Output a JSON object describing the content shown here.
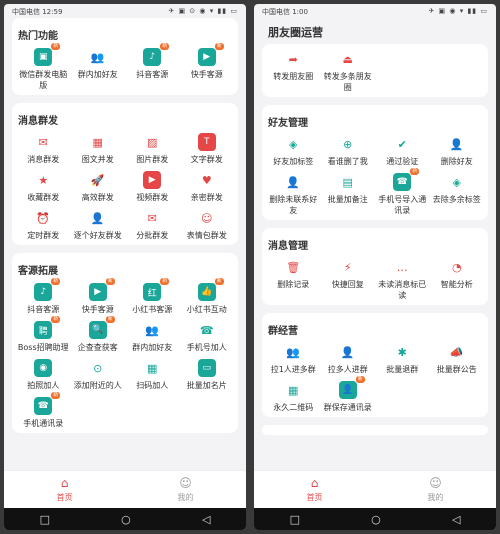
{
  "left": {
    "status": {
      "carrier": "中国电信 12:59",
      "icons": "✈ ▣ ⊙ ◉ ▾ ▮▮ ▭"
    },
    "sections": [
      {
        "title": "热门功能",
        "items": [
          {
            "label": "微信群发电脑版",
            "icon": "▣",
            "style": "tealbg",
            "badge": "新"
          },
          {
            "label": "群内加好友",
            "icon": "👥",
            "style": "teal"
          },
          {
            "label": "抖音客源",
            "icon": "♪",
            "style": "tealbg",
            "badge": "新"
          },
          {
            "label": "快手客源",
            "icon": "▶",
            "style": "tealbg",
            "badge": "新"
          }
        ]
      },
      {
        "title": "消息群发",
        "items": [
          {
            "label": "消息群发",
            "icon": "✉",
            "style": "red"
          },
          {
            "label": "图文并发",
            "icon": "▦",
            "style": "red"
          },
          {
            "label": "图片群发",
            "icon": "▨",
            "style": "red"
          },
          {
            "label": "文字群发",
            "icon": "T",
            "style": "redbg"
          },
          {
            "label": "收藏群发",
            "icon": "★",
            "style": "red"
          },
          {
            "label": "高效群发",
            "icon": "🚀",
            "style": "red"
          },
          {
            "label": "视频群发",
            "icon": "▶",
            "style": "redbg"
          },
          {
            "label": "亲密群发",
            "icon": "♥",
            "style": "red"
          },
          {
            "label": "定时群发",
            "icon": "⏰",
            "style": "red"
          },
          {
            "label": "逐个好友群发",
            "icon": "👤",
            "style": "red"
          },
          {
            "label": "分批群发",
            "icon": "✉",
            "style": "red"
          },
          {
            "label": "表情包群发",
            "icon": "☺",
            "style": "red"
          }
        ]
      },
      {
        "title": "客源拓展",
        "items": [
          {
            "label": "抖音客源",
            "icon": "♪",
            "style": "tealbg",
            "badge": "新"
          },
          {
            "label": "快手客源",
            "icon": "▶",
            "style": "tealbg",
            "badge": "新"
          },
          {
            "label": "小红书客源",
            "icon": "红",
            "style": "tealbg",
            "badge": "新"
          },
          {
            "label": "小红书互动",
            "icon": "👍",
            "style": "tealbg",
            "badge": "新"
          },
          {
            "label": "Boss招聘助理",
            "icon": "聘",
            "style": "tealbg",
            "badge": "新"
          },
          {
            "label": "企查查获客",
            "icon": "🔍",
            "style": "tealbg",
            "badge": "新"
          },
          {
            "label": "群内加好友",
            "icon": "👥",
            "style": "teal"
          },
          {
            "label": "手机号加人",
            "icon": "☎",
            "style": "teal"
          },
          {
            "label": "拍照加人",
            "icon": "◉",
            "style": "tealbg"
          },
          {
            "label": "添加附近的人",
            "icon": "⊙",
            "style": "teal"
          },
          {
            "label": "扫码加人",
            "icon": "▦",
            "style": "teal"
          },
          {
            "label": "批量加名片",
            "icon": "▭",
            "style": "tealbg"
          },
          {
            "label": "手机通讯录",
            "icon": "☎",
            "style": "tealbg",
            "badge": "新"
          }
        ]
      }
    ],
    "tabs": [
      {
        "label": "首页",
        "icon": "⌂",
        "active": true
      },
      {
        "label": "我的",
        "icon": "☺",
        "active": false
      }
    ]
  },
  "right": {
    "status": {
      "carrier": "中国电信 1:00",
      "icons": "✈ ▣ ◉ ▾ ▮▮ ▭"
    },
    "topic": "朋友圈运营",
    "sections": [
      {
        "title": "",
        "items": [
          {
            "label": "转发朋友圈",
            "icon": "➦",
            "style": "red"
          },
          {
            "label": "转发多条朋友圈",
            "icon": "⏏",
            "style": "red"
          }
        ]
      },
      {
        "title": "好友管理",
        "items": [
          {
            "label": "好友加标签",
            "icon": "◈",
            "style": "teal"
          },
          {
            "label": "看谁删了我",
            "icon": "⊕",
            "style": "teal"
          },
          {
            "label": "通过验证",
            "icon": "✔",
            "style": "teal"
          },
          {
            "label": "删除好友",
            "icon": "👤",
            "style": "teal"
          },
          {
            "label": "删除未联系好友",
            "icon": "👤",
            "style": "teal"
          },
          {
            "label": "批量加备注",
            "icon": "▤",
            "style": "teal"
          },
          {
            "label": "手机号导入通讯录",
            "icon": "☎",
            "style": "tealbg",
            "badge": "新"
          },
          {
            "label": "去除多余标签",
            "icon": "◈",
            "style": "teal"
          }
        ]
      },
      {
        "title": "消息管理",
        "items": [
          {
            "label": "删除记录",
            "icon": "🗑",
            "style": "red"
          },
          {
            "label": "快捷回复",
            "icon": "⚡",
            "style": "red"
          },
          {
            "label": "未读消息标已读",
            "icon": "…",
            "style": "red"
          },
          {
            "label": "智能分析",
            "icon": "◔",
            "style": "red"
          }
        ]
      },
      {
        "title": "群经营",
        "items": [
          {
            "label": "拉1人进多群",
            "icon": "👥",
            "style": "teal"
          },
          {
            "label": "拉多人进群",
            "icon": "👤",
            "style": "teal"
          },
          {
            "label": "批量退群",
            "icon": "✱",
            "style": "teal"
          },
          {
            "label": "批量群公告",
            "icon": "📣",
            "style": "teal"
          },
          {
            "label": "永久二维码",
            "icon": "▦",
            "style": "teal"
          },
          {
            "label": "群保存通讯录",
            "icon": "👤",
            "style": "tealbg",
            "badge": "新"
          }
        ]
      },
      {
        "title": "",
        "items": []
      }
    ],
    "tabs": [
      {
        "label": "首页",
        "icon": "⌂",
        "active": true
      },
      {
        "label": "我的",
        "icon": "☺",
        "active": false
      }
    ]
  },
  "nav": {
    "square": "□",
    "circle": "○",
    "back": "◁"
  }
}
